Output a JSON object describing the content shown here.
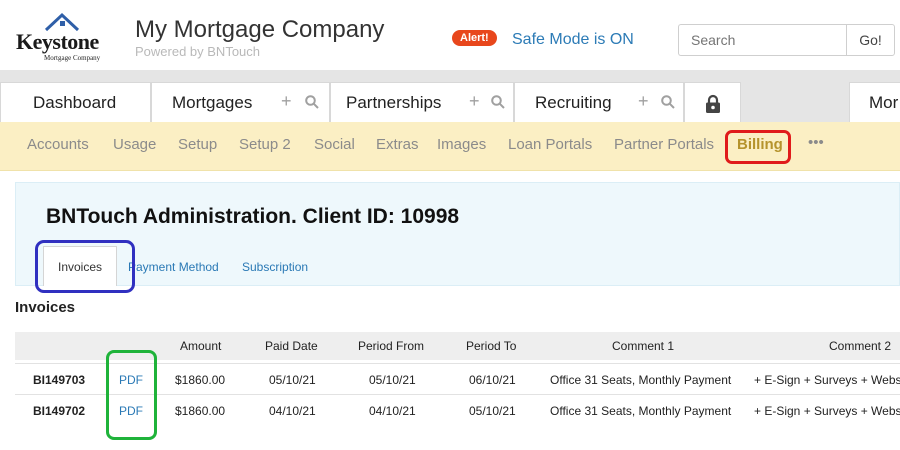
{
  "header": {
    "logo_text": "Keystone",
    "logo_subtext": "Mortgage Company",
    "title": "My Mortgage Company",
    "subtitle": "Powered by BNTouch",
    "alert_label": "Alert!",
    "safe_mode_label": "Safe Mode is ON",
    "search_placeholder": "Search",
    "search_button": "Go!"
  },
  "tabs": [
    {
      "label": "Dashboard"
    },
    {
      "label": "Mortgages"
    },
    {
      "label": "Partnerships"
    },
    {
      "label": "Recruiting"
    },
    {
      "label": "Mor"
    }
  ],
  "subnav": {
    "items": [
      "Accounts",
      "Usage",
      "Setup",
      "Setup 2",
      "Social",
      "Extras",
      "Images",
      "Loan Portals",
      "Partner Portals",
      "Billing"
    ],
    "more": "•••"
  },
  "admin": {
    "title": "BNTouch Administration. Client ID: 10998",
    "subtabs": [
      "Invoices",
      "Payment Method",
      "Subscription"
    ]
  },
  "invoices": {
    "section_title": "Invoices",
    "columns": [
      "",
      "",
      "Amount",
      "Paid Date",
      "Period From",
      "Period To",
      "Comment 1",
      "Comment 2"
    ],
    "rows": [
      {
        "id": "BI149703",
        "link": "PDF",
        "amount": "$1860.00",
        "paid_date": "05/10/21",
        "period_from": "05/10/21",
        "period_to": "06/10/21",
        "comment1": "Office 31 Seats, Monthly Payment",
        "comment2": "+ E-Sign + Surveys + Webs"
      },
      {
        "id": "BI149702",
        "link": "PDF",
        "amount": "$1860.00",
        "paid_date": "04/10/21",
        "period_from": "04/10/21",
        "period_to": "05/10/21",
        "comment1": "Office 31 Seats, Monthly Payment",
        "comment2": "+ E-Sign + Surveys + Webs"
      }
    ]
  },
  "colors": {
    "accent_blue": "#2c7bb6",
    "alert": "#e8471c",
    "subnav_bg": "#fbefc4",
    "billing_active": "#b5932c",
    "highlight_red": "#e01b1b",
    "highlight_blue": "#3030c0",
    "highlight_green": "#1fb33a"
  }
}
